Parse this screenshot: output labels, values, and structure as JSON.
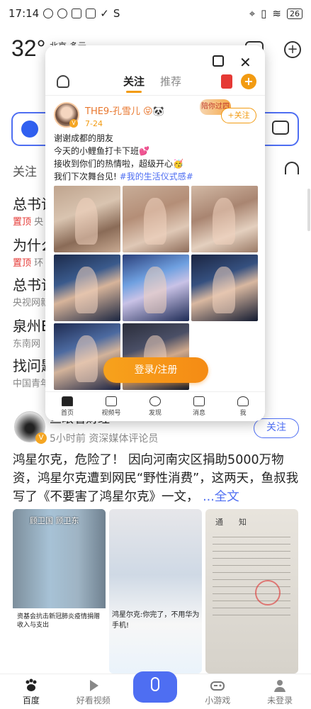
{
  "status_bar": {
    "time": "17:14",
    "battery": "26"
  },
  "weather": {
    "temperature": "32°",
    "city": "北京 多云"
  },
  "background": {
    "first_tab": "关注",
    "news": [
      {
        "title": "总书记",
        "sub_pin": "置顶",
        "sub": "央"
      },
      {
        "title": "为什么",
        "sub_pin": "置顶",
        "sub": "环"
      },
      {
        "title": "总书记",
        "sub": "央视网新"
      },
      {
        "title": "泉州E",
        "sub": "东南网"
      },
      {
        "title": "找问题",
        "sub": "中国青年"
      }
    ]
  },
  "popup": {
    "tabs": [
      {
        "label": "关注",
        "active": true
      },
      {
        "label": "推荐",
        "active": false
      }
    ],
    "post": {
      "author": "THE9-孔雪儿 😝🐼",
      "date": "7-24",
      "deco_badge": "陪你过四",
      "follow": "+关注",
      "lines": [
        "谢谢成都的朋友",
        "今天的小鲤鱼打卡下班💕",
        "接收到你们的热情啦，超级开心🥳",
        "我们下次舞台见!"
      ],
      "hashtag": "#我的生活仪式感#"
    },
    "login_button": "登录/注册",
    "nav": [
      {
        "label": "首页",
        "icon": "home-icon"
      },
      {
        "label": "视频号",
        "icon": "video-icon"
      },
      {
        "label": "发现",
        "icon": "discover-icon"
      },
      {
        "label": "消息",
        "icon": "message-icon"
      },
      {
        "label": "我",
        "icon": "profile-icon"
      }
    ]
  },
  "feed_post": {
    "author": "鱼眼看财经",
    "meta": "5小时前  资深媒体评论员",
    "follow": "关注",
    "text": "鸿星尔克，危险了！ 因向河南灾区捐助5000万物资，鸿星尔克遭到网民“野性消费”，这两天，鱼叔我写了《不要害了鸿星尔克》一文，",
    "more": "...全文",
    "thumb1_tag": "顾卫国 顾卫东",
    "thumb1_doc": "资基会抗击新冠肺炎疫情捐赠收入与支出",
    "thumb2_head": "鸿星尔克:你完了，不用华为手机!",
    "thumb3_title": "通　　知"
  },
  "bottom_nav": [
    {
      "label": "百度",
      "active": true
    },
    {
      "label": "好看视频",
      "active": false
    },
    {
      "label": "",
      "active": false,
      "voice": true
    },
    {
      "label": "小游戏",
      "active": false
    },
    {
      "label": "未登录",
      "active": false
    }
  ],
  "colors": {
    "accent_blue": "#4e6ef2",
    "accent_orange": "#f29b12",
    "pin_red": "#e53935"
  }
}
